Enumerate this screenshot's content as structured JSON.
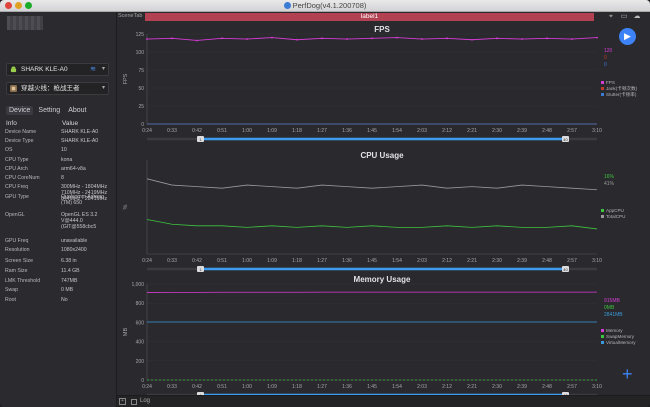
{
  "window": {
    "title": "PerfDog(v4.1.200708)"
  },
  "sidebar": {
    "device_select": "SHARK KLE-A0",
    "app_select": "穿越火线：枪战王者",
    "tabs": [
      "Device",
      "Setting",
      "About"
    ],
    "info_header": {
      "col1": "Info",
      "col2": "Value"
    },
    "info_rows": [
      {
        "k": "Device Name",
        "v": "SHARK KLE-A0"
      },
      {
        "k": "Device Type",
        "v": "SHARK KLE-A0"
      },
      {
        "k": "OS",
        "v": "10"
      },
      {
        "k": "CPU Type",
        "v": "kona"
      },
      {
        "k": "CPU Arch",
        "v": "arm64-v8a"
      },
      {
        "k": "CPU CoreNum",
        "v": "8"
      },
      {
        "k": "CPU Freq",
        "v": "300MHz - 1804MHz\n710MHz - 2419MHz\n844MHz - 2841MHz"
      },
      {
        "k": "GPU Type",
        "v": "Qualcomm Adreno\n(TM) 650"
      },
      {
        "k": "OpenGL",
        "v": "OpenGL ES 3.2\nV@444.0\n(GIT@558cbc5"
      },
      {
        "k": "GPU Freq",
        "v": "unavailable"
      },
      {
        "k": "Resolution",
        "v": "1080x2400"
      },
      {
        "k": "Screen Size",
        "v": "6.38 in"
      },
      {
        "k": "Ram Size",
        "v": "11.4 GB"
      },
      {
        "k": "LMK Threshold",
        "v": "747MB"
      },
      {
        "k": "Swap",
        "v": "0 MB"
      },
      {
        "k": "Root",
        "v": "No"
      }
    ]
  },
  "toolbar": {
    "scene_tab": "SceneTab",
    "label": "label1"
  },
  "bottom": {
    "log_label": "Log"
  },
  "colors": {
    "fps": "#d63bd6",
    "jank": "#c0392b",
    "stutter": "#3a7bd5",
    "app_cpu": "#3ec43e",
    "total_cpu": "#9a9a9a",
    "memory": "#d63bd6",
    "swap": "#3ec43e",
    "virtual": "#3a9ad9",
    "accent": "#3d82f6",
    "label_bar": "#b24252"
  },
  "time_ticks": [
    "0:24",
    "0:33",
    "0:42",
    "0:51",
    "1:00",
    "1:09",
    "1:18",
    "1:27",
    "1:36",
    "1:45",
    "1:54",
    "2:03",
    "2:12",
    "2:21",
    "2:30",
    "2:39",
    "2:48",
    "2:57",
    "3:10"
  ],
  "charts": {
    "fps": {
      "title": "FPS",
      "y_label": "FPS",
      "y_ticks": [
        "125",
        "100",
        "75",
        "50",
        "25",
        "0"
      ],
      "current": [
        "120",
        "0",
        "0"
      ],
      "legend": [
        "FPS",
        "Jank(卡顿次数)",
        "Stutter(卡顿率)"
      ],
      "range": [
        "1",
        "40"
      ]
    },
    "cpu": {
      "title": "CPU Usage",
      "y_label": "%",
      "current": [
        "16%",
        "41%"
      ],
      "legend": [
        "AppCPU",
        "TotalCPU"
      ],
      "range": [
        "1",
        "40"
      ]
    },
    "memory": {
      "title": "Memory Usage",
      "y_label": "MB",
      "y_ticks": [
        "1,000",
        "800",
        "600",
        "400",
        "200",
        "0"
      ],
      "current": [
        "915MB",
        "0MB",
        "2841MB"
      ],
      "legend": [
        "Memory",
        "SwapMemory",
        "VirtualMemory"
      ],
      "range": [
        "1",
        "40"
      ]
    }
  },
  "chart_data": [
    {
      "type": "line",
      "title": "FPS",
      "ylabel": "FPS",
      "x": [
        "0:24",
        "0:33",
        "0:42",
        "0:51",
        "1:00",
        "1:09",
        "1:18",
        "1:27",
        "1:36",
        "1:45",
        "1:54",
        "2:03",
        "2:12",
        "2:21",
        "2:30",
        "2:39",
        "2:48",
        "2:57",
        "3:10"
      ],
      "ylim": [
        0,
        125
      ],
      "series": [
        {
          "name": "FPS",
          "values": [
            118,
            119,
            116,
            119,
            118,
            120,
            117,
            119,
            118,
            119,
            120,
            118,
            119,
            117,
            119,
            118,
            119,
            118,
            120
          ]
        },
        {
          "name": "Jank(卡顿次数)",
          "values": [
            0,
            0,
            0,
            0,
            0,
            0,
            0,
            0,
            0,
            0,
            0,
            0,
            0,
            0,
            0,
            0,
            0,
            0,
            0
          ]
        },
        {
          "name": "Stutter(卡顿率)",
          "values": [
            0,
            0,
            0,
            0,
            0,
            0,
            0,
            0,
            0,
            0,
            0,
            0,
            0,
            0,
            0,
            0,
            0,
            0,
            0
          ]
        }
      ]
    },
    {
      "type": "line",
      "title": "CPU Usage",
      "ylabel": "%",
      "x": [
        "0:24",
        "0:33",
        "0:42",
        "0:51",
        "1:00",
        "1:09",
        "1:18",
        "1:27",
        "1:36",
        "1:45",
        "1:54",
        "2:03",
        "2:12",
        "2:21",
        "2:30",
        "2:39",
        "2:48",
        "2:57",
        "3:10"
      ],
      "series": [
        {
          "name": "AppCPU",
          "values": [
            22,
            19,
            18,
            18,
            17,
            18,
            17,
            18,
            17,
            18,
            17,
            17,
            18,
            17,
            18,
            17,
            17,
            18,
            16
          ]
        },
        {
          "name": "TotalCPU",
          "values": [
            48,
            44,
            43,
            42,
            44,
            43,
            42,
            44,
            43,
            42,
            43,
            44,
            42,
            43,
            42,
            44,
            43,
            42,
            41
          ]
        }
      ]
    },
    {
      "type": "line",
      "title": "Memory Usage",
      "ylabel": "MB",
      "x": [
        "0:24",
        "0:33",
        "0:42",
        "0:51",
        "1:00",
        "1:09",
        "1:18",
        "1:27",
        "1:36",
        "1:45",
        "1:54",
        "2:03",
        "2:12",
        "2:21",
        "2:30",
        "2:39",
        "2:48",
        "2:57",
        "3:10"
      ],
      "ylim": [
        0,
        1000
      ],
      "series": [
        {
          "name": "Memory",
          "values": [
            912,
            913,
            913,
            914,
            914,
            914,
            914,
            915,
            915,
            915,
            915,
            915,
            915,
            915,
            915,
            915,
            915,
            915,
            915
          ]
        },
        {
          "name": "SwapMemory",
          "values": [
            0,
            0,
            0,
            0,
            0,
            0,
            0,
            0,
            0,
            0,
            0,
            0,
            0,
            0,
            0,
            0,
            0,
            0,
            0
          ]
        },
        {
          "name": "VirtualMemory",
          "values": [
            2841,
            2841,
            2841,
            2841,
            2841,
            2841,
            2841,
            2841,
            2841,
            2841,
            2841,
            2841,
            2841,
            2841,
            2841,
            2841,
            2841,
            2841,
            2841
          ]
        }
      ]
    }
  ]
}
